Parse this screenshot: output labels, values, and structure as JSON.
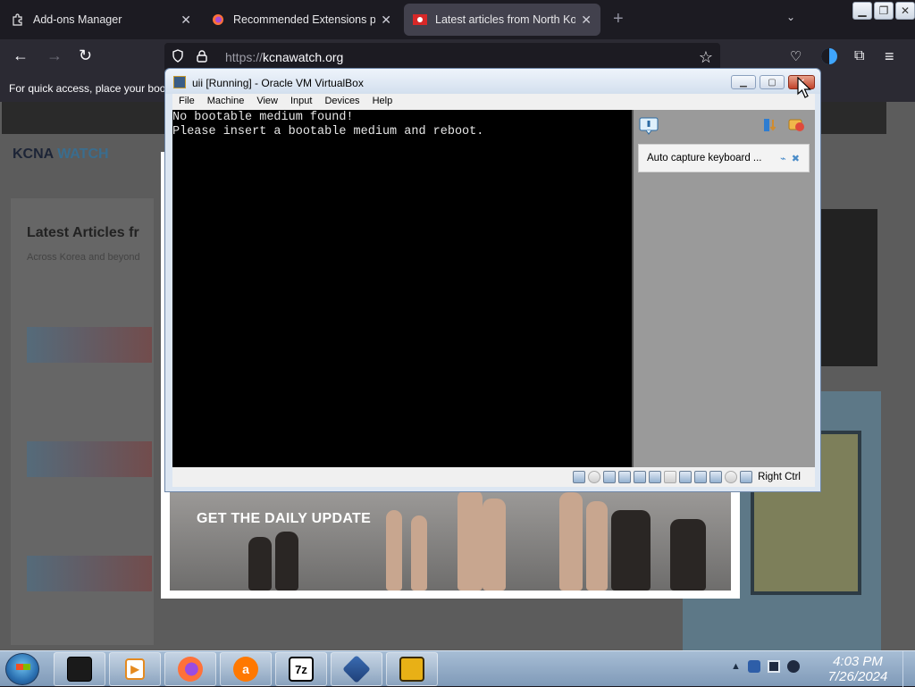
{
  "browser": {
    "tabs": [
      {
        "label": "Add-ons Manager",
        "icon": "puzzle-icon",
        "active": false
      },
      {
        "label": "Recommended Extensions prog",
        "icon": "firefox-icon",
        "active": false
      },
      {
        "label": "Latest articles from North Korea",
        "icon": "kcnawatch-flag-icon",
        "active": true
      }
    ],
    "url_protocol": "https://",
    "url_host": "kcnawatch.org",
    "bookmark_hint": "For quick access, place your book"
  },
  "site": {
    "logo_left": "KCNA",
    "logo_right": "WATCH",
    "section_heading": "Latest Articles fr",
    "section_sub": "Across Korea and beyond",
    "popup_cta": "GET THE DAILY UPDATE"
  },
  "vbox": {
    "title": "uii [Running] - Oracle VM VirtualBox",
    "menu": [
      "File",
      "Machine",
      "View",
      "Input",
      "Devices",
      "Help"
    ],
    "screen_lines": [
      "No bootable medium found!",
      "Please insert a bootable medium and reboot."
    ],
    "notice_text": "Auto capture keyboard ...",
    "host_key": "Right Ctrl"
  },
  "taskbar": {
    "clock_time": "4:03 PM",
    "clock_date": "7/26/2024",
    "items": [
      "terminal-app",
      "media-player",
      "firefox",
      "avast",
      "7zip",
      "virtualbox",
      "app-yellow"
    ]
  }
}
